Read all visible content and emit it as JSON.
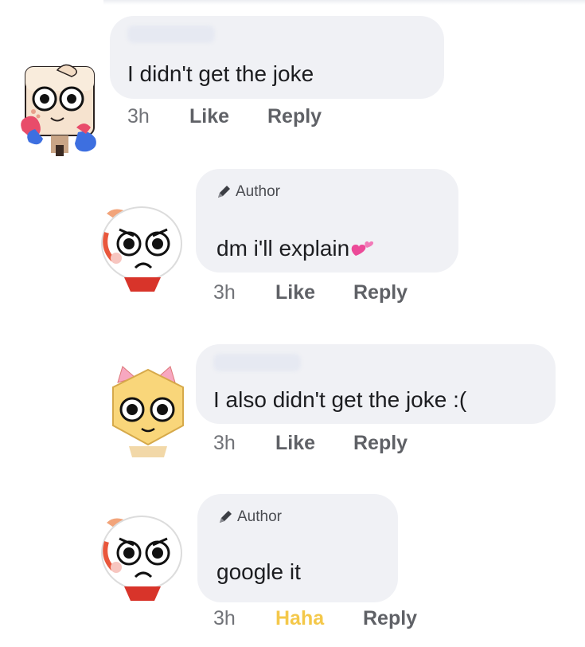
{
  "comments": [
    {
      "text": "I didn't get the joke",
      "time": "3h",
      "reaction": "Like",
      "reply": "Reply",
      "avatar_icon": "cube-character-avatar"
    },
    {
      "author_label": "Author",
      "text": "dm i'll explain",
      "emoji": "two-hearts-emoji",
      "time": "3h",
      "reaction": "Like",
      "reply": "Reply",
      "avatar_icon": "frowning-character-avatar"
    },
    {
      "text": "I also didn't get the joke :(",
      "time": "3h",
      "reaction": "Like",
      "reply": "Reply",
      "avatar_icon": "smiling-yellow-character-avatar"
    },
    {
      "author_label": "Author",
      "text": "google it",
      "time": "3h",
      "reaction": "Haha",
      "reply": "Reply",
      "avatar_icon": "frowning-character-avatar"
    }
  ],
  "colors": {
    "bubble": "#f0f1f5",
    "haha_active": "#f4c84a",
    "meta_text": "#5f6166"
  }
}
